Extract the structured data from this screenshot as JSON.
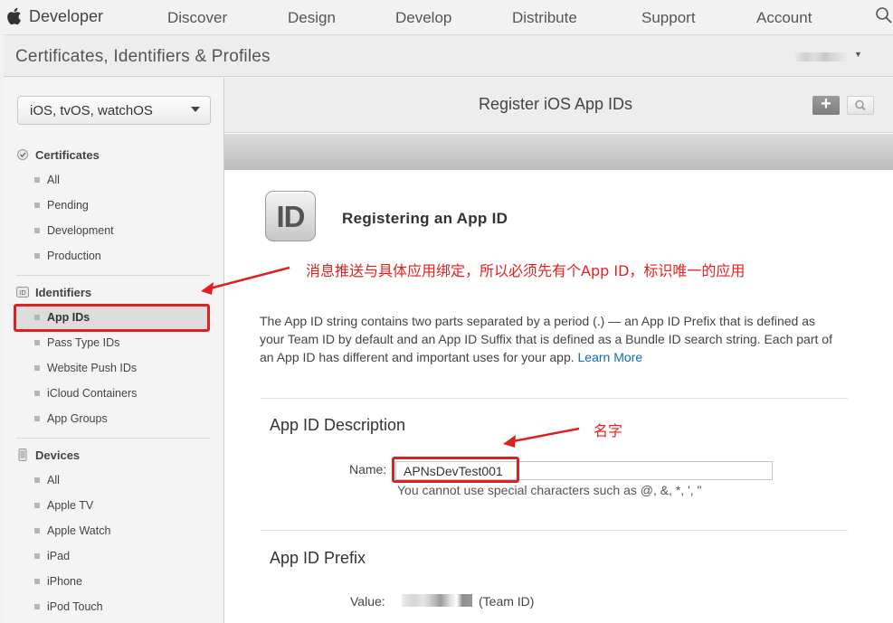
{
  "topnav": {
    "brand": "Developer",
    "items": [
      "Discover",
      "Design",
      "Develop",
      "Distribute",
      "Support",
      "Account"
    ]
  },
  "section_header": {
    "title": "Certificates, Identifiers & Profiles"
  },
  "sidebar": {
    "platform": "iOS, tvOS, watchOS",
    "certificates": {
      "title": "Certificates",
      "items": [
        "All",
        "Pending",
        "Development",
        "Production"
      ]
    },
    "identifiers": {
      "title": "Identifiers",
      "items": [
        "App IDs",
        "Pass Type IDs",
        "Website Push IDs",
        "iCloud Containers",
        "App Groups"
      ]
    },
    "devices": {
      "title": "Devices",
      "items": [
        "All",
        "Apple TV",
        "Apple Watch",
        "iPad",
        "iPhone",
        "iPod Touch"
      ]
    }
  },
  "main": {
    "title": "Register iOS App IDs",
    "icon_text": "ID",
    "registering_title": "Registering an App ID",
    "description": "The App ID string contains two parts separated by a period (.) — an App ID Prefix that is defined as your Team ID by default and an App ID Suffix that is defined as a Bundle ID search string. Each part of an App ID has different and important uses for your app.",
    "learn_more": "Learn More",
    "description_section": {
      "title": "App ID Description",
      "name_label": "Name:",
      "name_value": "APNsDevTest001",
      "hint": "You cannot use special characters such as @, &, *, ', \""
    },
    "prefix_section": {
      "title": "App ID Prefix",
      "value_label": "Value:",
      "value_suffix": "(Team ID)"
    }
  },
  "annotations": {
    "app_id_note": "消息推送与具体应用绑定，所以必须先有个App ID，标识唯一的应用",
    "name_note": "名字",
    "color": "#e32020"
  }
}
